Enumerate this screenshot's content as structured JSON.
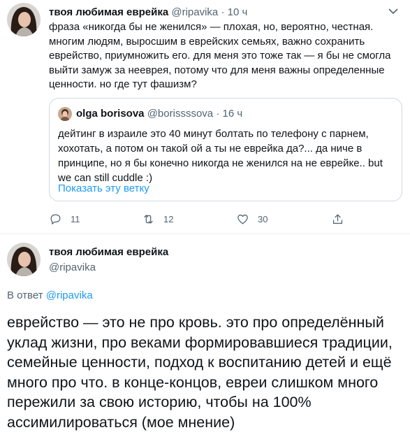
{
  "tweet1": {
    "author_name": "твоя любимая еврейка",
    "author_handle": "@ripavika",
    "separator": "·",
    "time": "10 ч",
    "text": "фраза «никогда бы не женился» — плохая, но, вероятно, честная. многим людям, выросшим в еврейских семьях, важно сохранить еврейство, приумножить его. для меня это тоже так — я бы не смогла выйти замуж за нееврея, потому что для меня важны определенные ценности. но где тут фашизм?",
    "quote": {
      "author_name": "olga borisova",
      "author_handle": "@borissssova",
      "separator": "·",
      "time": "16 ч",
      "text": "дейтинг в израиле это 40 минут болтать по телефону с парнем, хохотать, а потом он такой ой а ты не еврейка да?... да ниче в принципе, но я бы конечно никогда не женился на не еврейке.. but we can still cuddle :)",
      "show_thread": "Показать эту ветку"
    },
    "actions": {
      "reply_count": "11",
      "retweet_count": "12",
      "like_count": "30"
    }
  },
  "tweet2": {
    "author_name": "твоя любимая еврейка",
    "author_handle": "@ripavika",
    "replying_prefix": "В ответ",
    "replying_to": "@ripavika",
    "text": "еврейство — это не про кровь. это про определённый уклад жизни, про  веками формировавшиеся традиции, семейные ценности, подход к воспитанию детей и ещё много про что. в конце-концов, евреи слишком много пережили за свою историю, чтобы на 100% ассимилироваться (мое мнение)"
  },
  "icons": [
    "caret-down-icon",
    "reply-icon",
    "retweet-icon",
    "like-icon",
    "share-icon"
  ],
  "colors": {
    "accent": "#1d9bf0",
    "secondary_text": "#536471",
    "border": "#cfd9de"
  }
}
